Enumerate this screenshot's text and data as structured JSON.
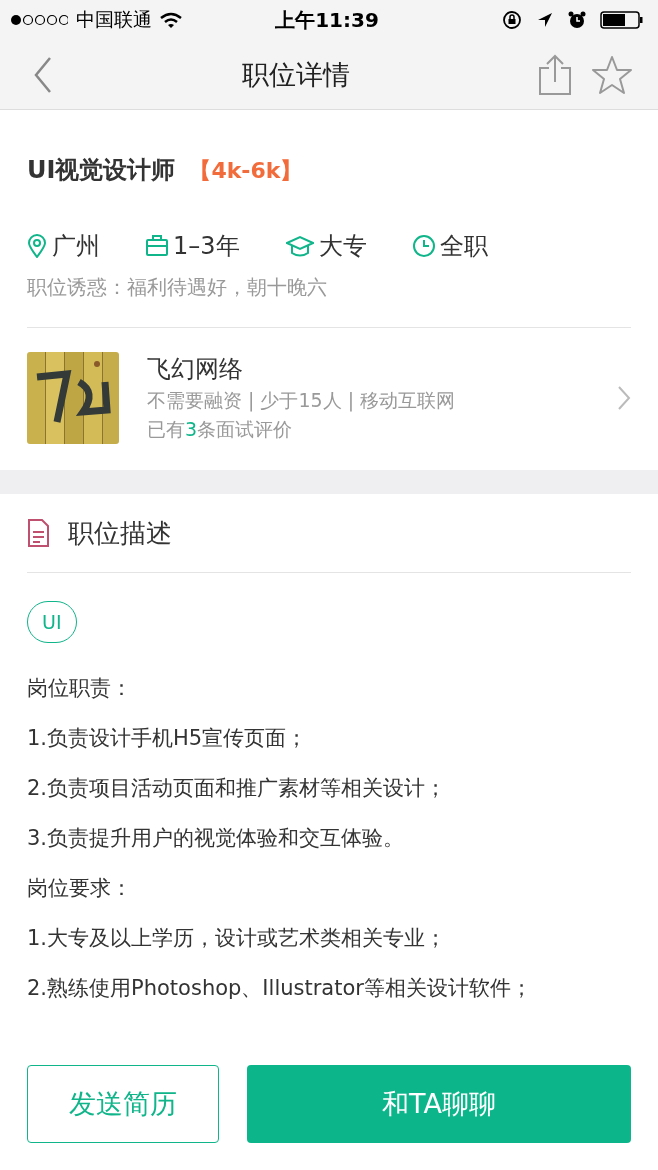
{
  "status_bar": {
    "carrier": "中国联通",
    "time": "上午11:39"
  },
  "nav": {
    "title": "职位详情"
  },
  "job": {
    "title": "UI视觉设计师",
    "salary": "【4k-6k】",
    "attributes": [
      {
        "kind": "location",
        "text": "广州"
      },
      {
        "kind": "experience",
        "text": "1–3年"
      },
      {
        "kind": "education",
        "text": "大专"
      },
      {
        "kind": "type",
        "text": "全职"
      }
    ],
    "perks": "职位诱惑：福利待遇好，朝十晚六"
  },
  "company": {
    "name": "飞幻网络",
    "meta": "不需要融资 | 少于15人 | 移动互联网",
    "reviews_prefix": "已有",
    "reviews_count": "3",
    "reviews_suffix": "条面试评价"
  },
  "description": {
    "heading": "职位描述",
    "tags": [
      "UI"
    ],
    "lines": [
      "岗位职责：",
      "1.负责设计手机H5宣传页面；",
      "2.负责项目活动页面和推广素材等相关设计；",
      "3.负责提升用户的视觉体验和交互体验。",
      "岗位要求：",
      "1.大专及以上学历，设计或艺术类相关专业；",
      "2.熟练使用Photoshop、Illustrator等相关设计软件；"
    ]
  },
  "actions": [
    {
      "kind": "outline",
      "label": "发送简历"
    },
    {
      "kind": "primary",
      "label": "和TA聊聊"
    }
  ]
}
